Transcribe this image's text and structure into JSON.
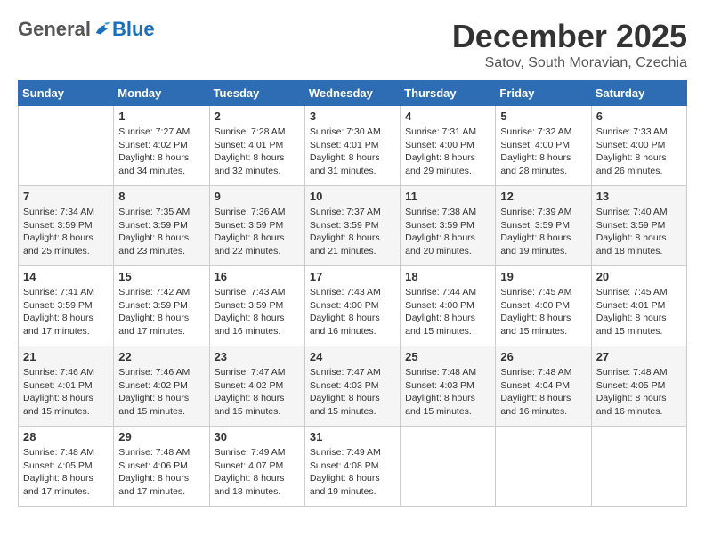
{
  "header": {
    "logo": {
      "general": "General",
      "blue": "Blue",
      "tagline": "GeneralBlue"
    },
    "title": "December 2025",
    "subtitle": "Satov, South Moravian, Czechia"
  },
  "weekdays": [
    "Sunday",
    "Monday",
    "Tuesday",
    "Wednesday",
    "Thursday",
    "Friday",
    "Saturday"
  ],
  "weeks": [
    [
      {
        "day": "",
        "sunrise": "",
        "sunset": "",
        "daylight": ""
      },
      {
        "day": "1",
        "sunrise": "Sunrise: 7:27 AM",
        "sunset": "Sunset: 4:02 PM",
        "daylight": "Daylight: 8 hours and 34 minutes."
      },
      {
        "day": "2",
        "sunrise": "Sunrise: 7:28 AM",
        "sunset": "Sunset: 4:01 PM",
        "daylight": "Daylight: 8 hours and 32 minutes."
      },
      {
        "day": "3",
        "sunrise": "Sunrise: 7:30 AM",
        "sunset": "Sunset: 4:01 PM",
        "daylight": "Daylight: 8 hours and 31 minutes."
      },
      {
        "day": "4",
        "sunrise": "Sunrise: 7:31 AM",
        "sunset": "Sunset: 4:00 PM",
        "daylight": "Daylight: 8 hours and 29 minutes."
      },
      {
        "day": "5",
        "sunrise": "Sunrise: 7:32 AM",
        "sunset": "Sunset: 4:00 PM",
        "daylight": "Daylight: 8 hours and 28 minutes."
      },
      {
        "day": "6",
        "sunrise": "Sunrise: 7:33 AM",
        "sunset": "Sunset: 4:00 PM",
        "daylight": "Daylight: 8 hours and 26 minutes."
      }
    ],
    [
      {
        "day": "7",
        "sunrise": "Sunrise: 7:34 AM",
        "sunset": "Sunset: 3:59 PM",
        "daylight": "Daylight: 8 hours and 25 minutes."
      },
      {
        "day": "8",
        "sunrise": "Sunrise: 7:35 AM",
        "sunset": "Sunset: 3:59 PM",
        "daylight": "Daylight: 8 hours and 23 minutes."
      },
      {
        "day": "9",
        "sunrise": "Sunrise: 7:36 AM",
        "sunset": "Sunset: 3:59 PM",
        "daylight": "Daylight: 8 hours and 22 minutes."
      },
      {
        "day": "10",
        "sunrise": "Sunrise: 7:37 AM",
        "sunset": "Sunset: 3:59 PM",
        "daylight": "Daylight: 8 hours and 21 minutes."
      },
      {
        "day": "11",
        "sunrise": "Sunrise: 7:38 AM",
        "sunset": "Sunset: 3:59 PM",
        "daylight": "Daylight: 8 hours and 20 minutes."
      },
      {
        "day": "12",
        "sunrise": "Sunrise: 7:39 AM",
        "sunset": "Sunset: 3:59 PM",
        "daylight": "Daylight: 8 hours and 19 minutes."
      },
      {
        "day": "13",
        "sunrise": "Sunrise: 7:40 AM",
        "sunset": "Sunset: 3:59 PM",
        "daylight": "Daylight: 8 hours and 18 minutes."
      }
    ],
    [
      {
        "day": "14",
        "sunrise": "Sunrise: 7:41 AM",
        "sunset": "Sunset: 3:59 PM",
        "daylight": "Daylight: 8 hours and 17 minutes."
      },
      {
        "day": "15",
        "sunrise": "Sunrise: 7:42 AM",
        "sunset": "Sunset: 3:59 PM",
        "daylight": "Daylight: 8 hours and 17 minutes."
      },
      {
        "day": "16",
        "sunrise": "Sunrise: 7:43 AM",
        "sunset": "Sunset: 3:59 PM",
        "daylight": "Daylight: 8 hours and 16 minutes."
      },
      {
        "day": "17",
        "sunrise": "Sunrise: 7:43 AM",
        "sunset": "Sunset: 4:00 PM",
        "daylight": "Daylight: 8 hours and 16 minutes."
      },
      {
        "day": "18",
        "sunrise": "Sunrise: 7:44 AM",
        "sunset": "Sunset: 4:00 PM",
        "daylight": "Daylight: 8 hours and 15 minutes."
      },
      {
        "day": "19",
        "sunrise": "Sunrise: 7:45 AM",
        "sunset": "Sunset: 4:00 PM",
        "daylight": "Daylight: 8 hours and 15 minutes."
      },
      {
        "day": "20",
        "sunrise": "Sunrise: 7:45 AM",
        "sunset": "Sunset: 4:01 PM",
        "daylight": "Daylight: 8 hours and 15 minutes."
      }
    ],
    [
      {
        "day": "21",
        "sunrise": "Sunrise: 7:46 AM",
        "sunset": "Sunset: 4:01 PM",
        "daylight": "Daylight: 8 hours and 15 minutes."
      },
      {
        "day": "22",
        "sunrise": "Sunrise: 7:46 AM",
        "sunset": "Sunset: 4:02 PM",
        "daylight": "Daylight: 8 hours and 15 minutes."
      },
      {
        "day": "23",
        "sunrise": "Sunrise: 7:47 AM",
        "sunset": "Sunset: 4:02 PM",
        "daylight": "Daylight: 8 hours and 15 minutes."
      },
      {
        "day": "24",
        "sunrise": "Sunrise: 7:47 AM",
        "sunset": "Sunset: 4:03 PM",
        "daylight": "Daylight: 8 hours and 15 minutes."
      },
      {
        "day": "25",
        "sunrise": "Sunrise: 7:48 AM",
        "sunset": "Sunset: 4:03 PM",
        "daylight": "Daylight: 8 hours and 15 minutes."
      },
      {
        "day": "26",
        "sunrise": "Sunrise: 7:48 AM",
        "sunset": "Sunset: 4:04 PM",
        "daylight": "Daylight: 8 hours and 16 minutes."
      },
      {
        "day": "27",
        "sunrise": "Sunrise: 7:48 AM",
        "sunset": "Sunset: 4:05 PM",
        "daylight": "Daylight: 8 hours and 16 minutes."
      }
    ],
    [
      {
        "day": "28",
        "sunrise": "Sunrise: 7:48 AM",
        "sunset": "Sunset: 4:05 PM",
        "daylight": "Daylight: 8 hours and 17 minutes."
      },
      {
        "day": "29",
        "sunrise": "Sunrise: 7:48 AM",
        "sunset": "Sunset: 4:06 PM",
        "daylight": "Daylight: 8 hours and 17 minutes."
      },
      {
        "day": "30",
        "sunrise": "Sunrise: 7:49 AM",
        "sunset": "Sunset: 4:07 PM",
        "daylight": "Daylight: 8 hours and 18 minutes."
      },
      {
        "day": "31",
        "sunrise": "Sunrise: 7:49 AM",
        "sunset": "Sunset: 4:08 PM",
        "daylight": "Daylight: 8 hours and 19 minutes."
      },
      {
        "day": "",
        "sunrise": "",
        "sunset": "",
        "daylight": ""
      },
      {
        "day": "",
        "sunrise": "",
        "sunset": "",
        "daylight": ""
      },
      {
        "day": "",
        "sunrise": "",
        "sunset": "",
        "daylight": ""
      }
    ]
  ]
}
